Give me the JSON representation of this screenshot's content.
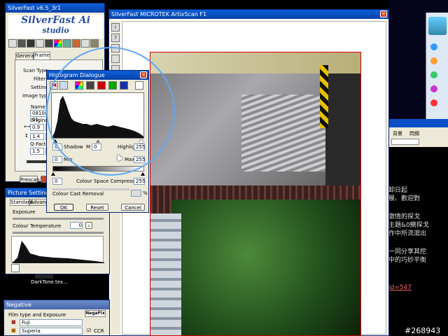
{
  "silverfast": {
    "title": "SilverFast v6.5_3r1",
    "logo1": "SilverFast Ai",
    "logo2": "studio",
    "tabs": [
      "General",
      "Frame"
    ],
    "labels": {
      "scan_type": "Scan Type:",
      "filter": "Filter:",
      "setting": "Setting:",
      "image_type": "Image type:",
      "name": "Name:",
      "name_value": "0810022-01",
      "original": "Original",
      "sc": "Sc",
      "v1": "0.9",
      "v2": "1.4",
      "v3": "1.5",
      "v3b": "10",
      "q_factor": "Q-Factor Scre",
      "prescan": "Prescan"
    }
  },
  "histogram": {
    "title": "Histogram Dialogue",
    "shadow": "Shadow",
    "shadow_val": "0",
    "m_label": "M",
    "m_val": "0",
    "highlight": "Highlight",
    "highlight_val": "255",
    "min": "Min",
    "min_val": "0",
    "max": "Max",
    "max_val": "255",
    "csc": "Colour Space Compression",
    "csc_left": "0",
    "csc_right": "255",
    "ccr": "Colour Cast Removal",
    "pct": "%",
    "ok": "OK",
    "reset": "Reset",
    "cancel": "Cancel"
  },
  "picture": {
    "title": "Picture Settings",
    "tabs": [
      "Standard",
      "Advance"
    ],
    "exposure": "Exposure",
    "ct": "Colour Temperature",
    "ct_val": "0"
  },
  "negative": {
    "title": "Negative",
    "film": "Film type and Exposure",
    "brand": "NegaFix",
    "opt1": "Fuji",
    "opt2": "Superia",
    "ccr": "CCR"
  },
  "artiscan": {
    "title": "SilverFast MICROTEK ArtixScan F1",
    "tools": [
      "i",
      "?",
      "Q",
      "",
      "",
      "",
      "",
      "",
      "",
      "",
      "",
      "",
      ""
    ]
  },
  "desktop": {
    "icon_label": "DarkTone.tex...",
    "watermark": "#268943"
  },
  "chat": {
    "lines": [
      "卸日起",
      "展、歡迎對",
      "激情的探戈",
      "主題&0鰂探戈",
      "作中所流瀉出",
      "一同分享其挖",
      "中的巧妙平衡",
      "id=547"
    ],
    "tab1": "背景",
    "tab2": "閃頻"
  }
}
